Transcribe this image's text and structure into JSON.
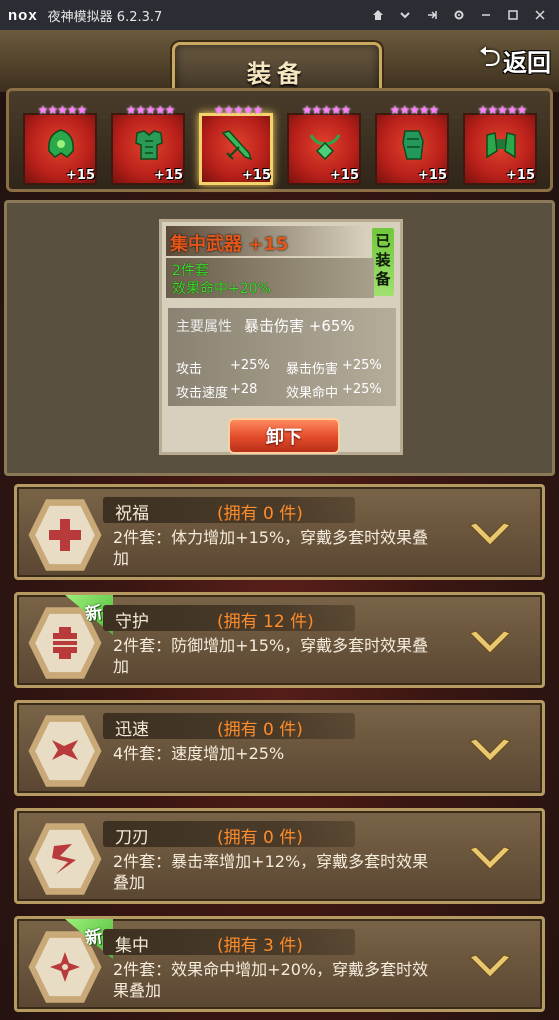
{
  "window": {
    "logo": "nox",
    "title": "夜神模拟器 6.2.3.7",
    "controls": [
      "home-icon",
      "dropdown-icon",
      "pin-icon",
      "settings-icon",
      "minimize-icon",
      "maximize-icon",
      "close-icon"
    ]
  },
  "header": {
    "title": "装备",
    "back_label": "返回"
  },
  "equipment": [
    {
      "stars": "★★★★★",
      "plus": "+15",
      "icon": "helmet-icon",
      "selected": false
    },
    {
      "stars": "★★★★★",
      "plus": "+15",
      "icon": "armor-icon",
      "selected": false
    },
    {
      "stars": "★★★★★",
      "plus": "+15",
      "icon": "weapon-icon",
      "selected": true
    },
    {
      "stars": "★★★★★",
      "plus": "+15",
      "icon": "necklace-icon",
      "selected": false
    },
    {
      "stars": "★★★★★",
      "plus": "+15",
      "icon": "gloves-icon",
      "selected": false
    },
    {
      "stars": "★★★★★",
      "plus": "+15",
      "icon": "boots-icon",
      "selected": false
    }
  ],
  "detail": {
    "title": "集中武器 +15",
    "equipped_tag": "已装备",
    "set_line1": "2件套",
    "set_line2": "效果命中+20%",
    "main_label": "主要属性",
    "main_value": "暴击伤害 +65%",
    "subs": [
      {
        "label": "攻击",
        "value": "+25%"
      },
      {
        "label": "暴击伤害",
        "value": "+25%"
      },
      {
        "label": "攻击速度",
        "value": "+28"
      },
      {
        "label": "效果命中",
        "value": "+25%"
      }
    ],
    "unequip_label": "卸下"
  },
  "sets": [
    {
      "name": "祝福",
      "count": "(拥有 0 件)",
      "desc": "2件套：体力增加+15%，穿戴多套时效果叠加",
      "icon": "cross-icon",
      "is_new": false
    },
    {
      "name": "守护",
      "count": "(拥有 12 件)",
      "desc": "2件套：防御增加+15%，穿戴多套时效果叠加",
      "icon": "shield-icon",
      "is_new": true
    },
    {
      "name": "迅速",
      "count": "(拥有 0 件)",
      "desc": "4件套：速度增加+25%",
      "icon": "speed-icon",
      "is_new": false
    },
    {
      "name": "刀刃",
      "count": "(拥有 0 件)",
      "desc": "2件套：暴击率增加+12%，穿戴多套时效果叠加",
      "icon": "blade-icon",
      "is_new": false
    },
    {
      "name": "集中",
      "count": "(拥有 3 件)",
      "desc": "2件套：效果命中增加+20%，穿戴多套时效果叠加",
      "icon": "focus-icon",
      "is_new": true
    }
  ],
  "new_badge_label": "新",
  "colors": {
    "accent_gold": "#c9a85f",
    "set_count": "#ff8c2a",
    "set_bonus_green": "#3bdc2a",
    "slot_red": "#b8201a"
  }
}
